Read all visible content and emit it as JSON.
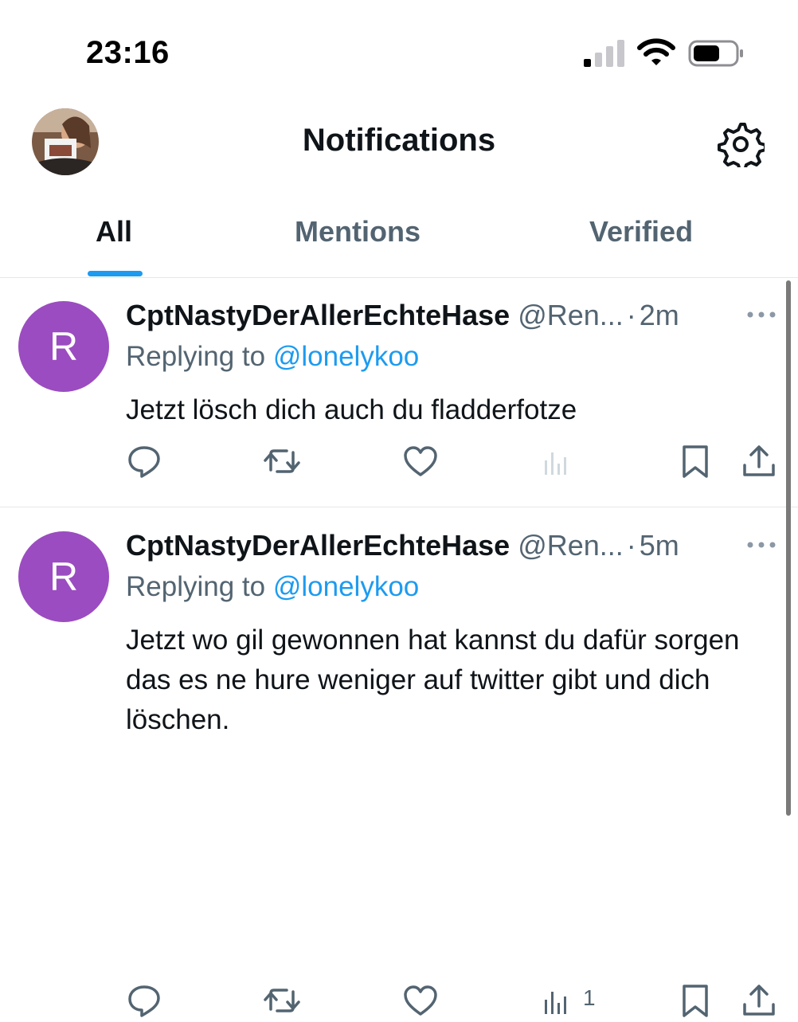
{
  "status_bar": {
    "time": "23:16"
  },
  "header": {
    "title": "Notifications"
  },
  "tabs": [
    {
      "label": "All",
      "active": true
    },
    {
      "label": "Mentions",
      "active": false
    },
    {
      "label": "Verified",
      "active": false
    }
  ],
  "notifications": [
    {
      "avatar_letter": "R",
      "avatar_color": "#9b4cc0",
      "name": "CptNastyDerAllerEchteHase",
      "handle": "@Ren...",
      "separator": "·",
      "time": "2m",
      "replying_prefix": "Replying to",
      "replying_to": "@lonelykoo",
      "text": "Jetzt lösch dich auch du fladderfotze",
      "views": ""
    },
    {
      "avatar_letter": "R",
      "avatar_color": "#9b4cc0",
      "name": "CptNastyDerAllerEchteHase",
      "handle": "@Ren...",
      "separator": "·",
      "time": "5m",
      "replying_prefix": "Replying to",
      "replying_to": "@lonelykoo",
      "text": "Jetzt wo gil gewonnen hat kannst du dafür sorgen das es ne hure weniger auf twitter gibt und dich löschen.",
      "views": "1"
    }
  ],
  "colors": {
    "accent": "#1d9bf0",
    "secondary_text": "#536471",
    "primary_text": "#0f1419"
  },
  "icons": [
    "signal-icon",
    "wifi-icon",
    "battery-icon",
    "settings-gear-icon",
    "more-icon",
    "reply-icon",
    "retweet-icon",
    "like-icon",
    "views-icon",
    "bookmark-icon",
    "share-icon"
  ]
}
